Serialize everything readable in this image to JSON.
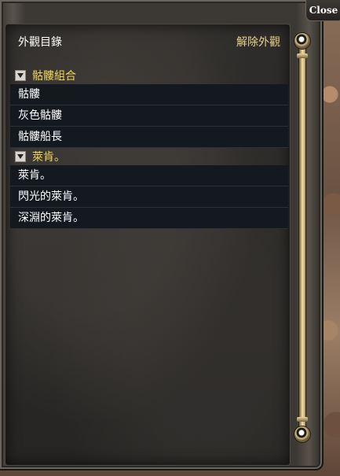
{
  "window": {
    "close_label": "Close"
  },
  "panel": {
    "title": "外觀目錄",
    "remove_label": "解除外觀"
  },
  "groups": [
    {
      "label": "骷髏組合",
      "expanded": true,
      "items": [
        "骷髏",
        "灰色骷髏",
        "骷髏船長"
      ]
    },
    {
      "label": "萊肯。",
      "expanded": true,
      "items": [
        "萊肯。",
        "閃光的萊肯。",
        "深淵的萊肯。"
      ]
    }
  ],
  "colors": {
    "group_label": "#f0d65a",
    "action_label": "#e8d28a",
    "item_bg": "#141920",
    "item_text": "#ffffff"
  },
  "icons": {
    "group_toggle": "expand-toggle-icon",
    "scroll_top": "scroll-up-knob-icon",
    "scroll_bottom": "scroll-down-knob-icon"
  }
}
